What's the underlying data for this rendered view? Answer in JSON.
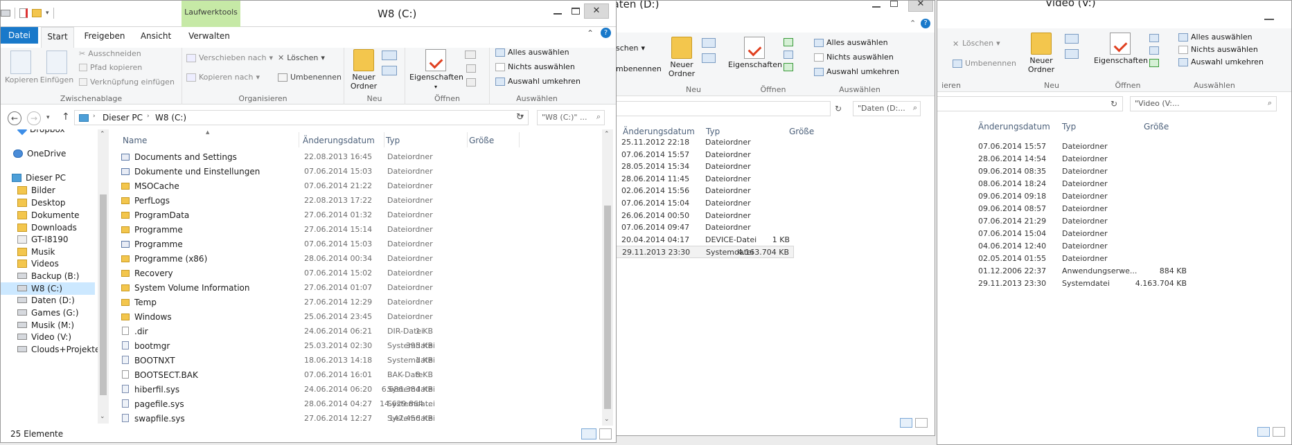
{
  "windows": {
    "video": {
      "title": "Video (V:)",
      "ribbon": {
        "delete": "Löschen",
        "rename": "Umbenennen",
        "new_folder": "Neuer Ordner",
        "properties": "Eigenschaften",
        "select_all": "Alles auswählen",
        "select_none": "Nichts auswählen",
        "invert": "Auswahl umkehren",
        "group_organize": "ieren",
        "group_new": "Neu",
        "group_open": "Öffnen",
        "group_select": "Auswählen"
      },
      "search_placeholder": "\"Video (V:...",
      "columns": {
        "date": "Änderungsdatum",
        "type": "Typ",
        "size": "Größe"
      },
      "rows": [
        {
          "date": "07.06.2014 15:57",
          "type": "Dateiordner",
          "size": ""
        },
        {
          "date": "28.06.2014 14:54",
          "type": "Dateiordner",
          "size": ""
        },
        {
          "date": "09.06.2014 08:35",
          "type": "Dateiordner",
          "size": ""
        },
        {
          "date": "08.06.2014 18:24",
          "type": "Dateiordner",
          "size": ""
        },
        {
          "date": "09.06.2014 09:18",
          "type": "Dateiordner",
          "size": ""
        },
        {
          "date": "09.06.2014 08:57",
          "type": "Dateiordner",
          "size": ""
        },
        {
          "date": "07.06.2014 21:29",
          "type": "Dateiordner",
          "size": ""
        },
        {
          "date": "07.06.2014 15:04",
          "type": "Dateiordner",
          "size": ""
        },
        {
          "date": "04.06.2014 12:40",
          "type": "Dateiordner",
          "size": ""
        },
        {
          "date": "02.05.2014 01:55",
          "type": "Dateiordner",
          "size": ""
        },
        {
          "date": "01.12.2006 22:37",
          "type": "Anwendungserwe...",
          "size": "884 KB"
        },
        {
          "date": "29.11.2013 23:30",
          "type": "Systemdatei",
          "size": "4.163.704 KB"
        }
      ]
    },
    "daten": {
      "title": "Daten (D:)",
      "ribbon": {
        "delete": "schen",
        "rename": "mbenennen",
        "new_folder": "Neuer Ordner",
        "properties": "Eigenschaften",
        "select_all": "Alles auswählen",
        "select_none": "Nichts auswählen",
        "invert": "Auswahl umkehren",
        "group_new": "Neu",
        "group_open": "Öffnen",
        "group_select": "Auswählen"
      },
      "search_placeholder": "\"Daten (D:...",
      "columns": {
        "date": "Änderungsdatum",
        "type": "Typ",
        "size": "Größe"
      },
      "rows": [
        {
          "date": "25.11.2012 22:18",
          "type": "Dateiordner",
          "size": ""
        },
        {
          "date": "07.06.2014 15:57",
          "type": "Dateiordner",
          "size": ""
        },
        {
          "date": "28.05.2014 15:34",
          "type": "Dateiordner",
          "size": ""
        },
        {
          "date": "28.06.2014 11:45",
          "type": "Dateiordner",
          "size": ""
        },
        {
          "date": "02.06.2014 15:56",
          "type": "Dateiordner",
          "size": ""
        },
        {
          "date": "07.06.2014 15:04",
          "type": "Dateiordner",
          "size": ""
        },
        {
          "date": "26.06.2014 00:50",
          "type": "Dateiordner",
          "size": ""
        },
        {
          "date": "07.06.2014 09:47",
          "type": "Dateiordner",
          "size": ""
        },
        {
          "date": "20.04.2014 04:17",
          "type": "DEVICE-Datei",
          "size": "1 KB"
        },
        {
          "date": "29.11.2013 23:30",
          "type": "Systemdatei",
          "size": "4.163.704 KB"
        }
      ]
    },
    "main": {
      "title": "W8 (C:)",
      "contextual_tab": "Laufwerktools",
      "tabs": [
        "Datei",
        "Start",
        "Freigeben",
        "Ansicht",
        "Verwalten"
      ],
      "ribbon": {
        "copy": "Kopieren",
        "paste": "Einfügen",
        "cut": "Ausschneiden",
        "copy_path": "Pfad kopieren",
        "paste_shortcut": "Verknüpfung einfügen",
        "group_clipboard": "Zwischenablage",
        "move_to": "Verschieben nach",
        "copy_to": "Kopieren nach",
        "delete": "Löschen",
        "rename": "Umbenennen",
        "group_organize": "Organisieren",
        "new_folder_1": "Neuer",
        "new_folder_2": "Ordner",
        "group_new": "Neu",
        "properties": "Eigenschaften",
        "group_open": "Öffnen",
        "select_all": "Alles auswählen",
        "select_none": "Nichts auswählen",
        "invert": "Auswahl umkehren",
        "group_select": "Auswählen"
      },
      "breadcrumb": [
        "Dieser PC",
        "W8 (C:)"
      ],
      "search_placeholder": "\"W8 (C:)\" ...",
      "columns": {
        "name": "Name",
        "date": "Änderungsdatum",
        "type": "Typ",
        "size": "Größe"
      },
      "nav": [
        {
          "label": "Dropbox",
          "icon": "dropbox-icon"
        },
        {
          "label": "OneDrive",
          "icon": "cloud-icon"
        },
        {
          "label": "Dieser PC",
          "icon": "computer-icon"
        },
        {
          "label": "Bilder",
          "icon": "folder-icon"
        },
        {
          "label": "Desktop",
          "icon": "folder-icon"
        },
        {
          "label": "Dokumente",
          "icon": "folder-icon"
        },
        {
          "label": "Downloads",
          "icon": "folder-icon"
        },
        {
          "label": "GT-I8190",
          "icon": "phone-icon"
        },
        {
          "label": "Musik",
          "icon": "folder-icon"
        },
        {
          "label": "Videos",
          "icon": "folder-icon"
        },
        {
          "label": "Backup (B:)",
          "icon": "drive-icon"
        },
        {
          "label": "W8 (C:)",
          "icon": "drive-icon"
        },
        {
          "label": "Daten (D:)",
          "icon": "drive-icon"
        },
        {
          "label": "Games (G:)",
          "icon": "drive-icon"
        },
        {
          "label": "Musik (M:)",
          "icon": "drive-icon"
        },
        {
          "label": "Video (V:)",
          "icon": "drive-icon"
        },
        {
          "label": "Clouds+Projekte",
          "icon": "drive-icon"
        }
      ],
      "rows": [
        {
          "name": "Documents and Settings",
          "date": "22.08.2013 16:45",
          "type": "Dateiordner",
          "size": "",
          "icon": "link"
        },
        {
          "name": "Dokumente und Einstellungen",
          "date": "07.06.2014 15:03",
          "type": "Dateiordner",
          "size": "",
          "icon": "link"
        },
        {
          "name": "MSOCache",
          "date": "07.06.2014 21:22",
          "type": "Dateiordner",
          "size": "",
          "icon": "folder"
        },
        {
          "name": "PerfLogs",
          "date": "22.08.2013 17:22",
          "type": "Dateiordner",
          "size": "",
          "icon": "folder"
        },
        {
          "name": "ProgramData",
          "date": "27.06.2014 01:32",
          "type": "Dateiordner",
          "size": "",
          "icon": "folder"
        },
        {
          "name": "Programme",
          "date": "27.06.2014 15:14",
          "type": "Dateiordner",
          "size": "",
          "icon": "folder"
        },
        {
          "name": "Programme",
          "date": "07.06.2014 15:03",
          "type": "Dateiordner",
          "size": "",
          "icon": "link"
        },
        {
          "name": "Programme (x86)",
          "date": "28.06.2014 00:34",
          "type": "Dateiordner",
          "size": "",
          "icon": "folder"
        },
        {
          "name": "Recovery",
          "date": "07.06.2014 15:02",
          "type": "Dateiordner",
          "size": "",
          "icon": "folder"
        },
        {
          "name": "System Volume Information",
          "date": "27.06.2014 01:07",
          "type": "Dateiordner",
          "size": "",
          "icon": "folder"
        },
        {
          "name": "Temp",
          "date": "27.06.2014 12:29",
          "type": "Dateiordner",
          "size": "",
          "icon": "folder"
        },
        {
          "name": "Windows",
          "date": "25.06.2014 23:45",
          "type": "Dateiordner",
          "size": "",
          "icon": "folder"
        },
        {
          "name": ".dir",
          "date": "24.06.2014 06:21",
          "type": "DIR-Datei",
          "size": "1 KB",
          "icon": "file"
        },
        {
          "name": "bootmgr",
          "date": "25.03.2014 02:30",
          "type": "Systemdatei",
          "size": "395 KB",
          "icon": "sys"
        },
        {
          "name": "BOOTNXT",
          "date": "18.06.2013 14:18",
          "type": "Systemdatei",
          "size": "1 KB",
          "icon": "sys"
        },
        {
          "name": "BOOTSECT.BAK",
          "date": "07.06.2014 16:01",
          "type": "BAK-Datei",
          "size": "8 KB",
          "icon": "file"
        },
        {
          "name": "hiberfil.sys",
          "date": "24.06.2014 06:20",
          "type": "Systemdatei",
          "size": "6.686.384 KB",
          "icon": "sys"
        },
        {
          "name": "pagefile.sys",
          "date": "28.06.2014 04:27",
          "type": "Systemdatei",
          "size": "14.629.864 ...",
          "icon": "sys"
        },
        {
          "name": "swapfile.sys",
          "date": "27.06.2014 12:27",
          "type": "Systemdatei",
          "size": "147.456 KB",
          "icon": "sys"
        }
      ],
      "status": "25 Elemente"
    }
  },
  "colors": {
    "accent": "#1979ca",
    "contextual": "#c6e9a6",
    "selection": "#cce8ff"
  }
}
